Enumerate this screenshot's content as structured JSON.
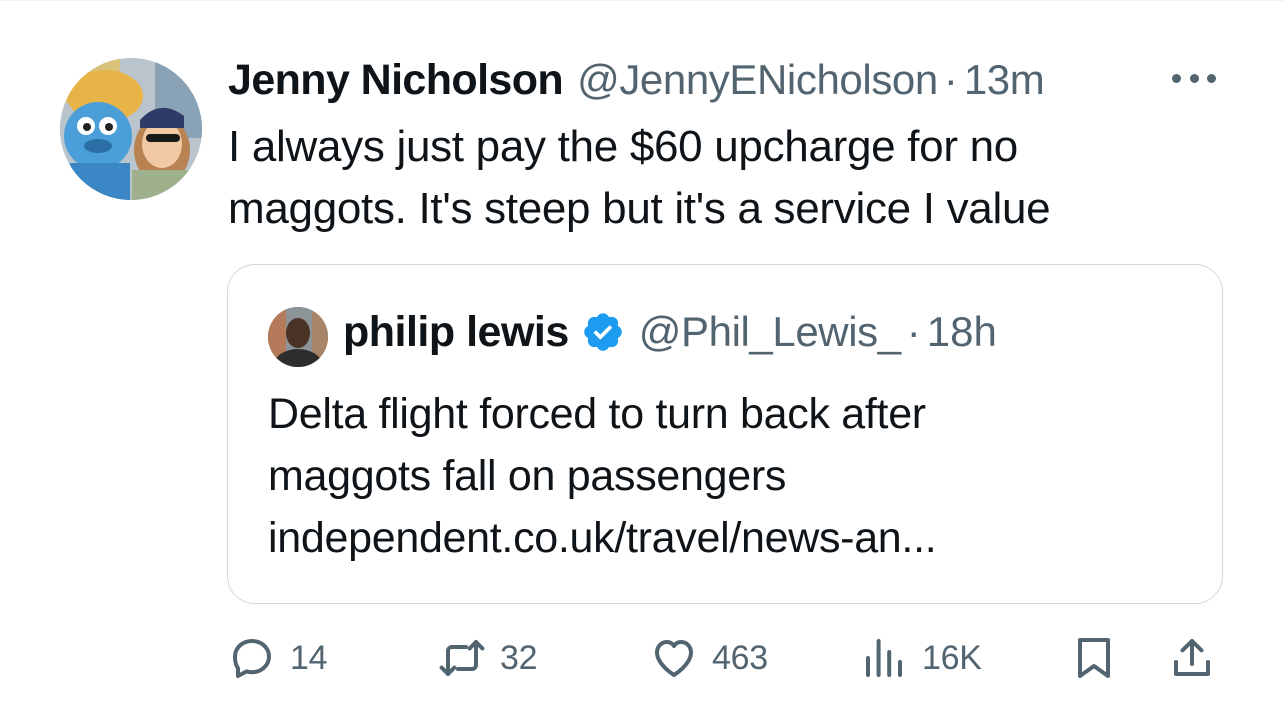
{
  "tweet": {
    "author_name": "Jenny Nicholson",
    "handle": "@JennyENicholson",
    "separator": "·",
    "time": "13m",
    "text_lines": [
      "I always just pay the $60 upcharge for no",
      "maggots. It's steep but it's a service I value"
    ]
  },
  "quoted": {
    "author_name": "philip lewis",
    "handle": "@Phil_Lewis_",
    "separator": "·",
    "time": "18h",
    "text_lines": [
      "Delta flight forced to turn back after",
      "maggots fall on passengers",
      "independent.co.uk/travel/news-an..."
    ]
  },
  "actions": {
    "replies": "14",
    "retweets": "32",
    "likes": "463",
    "views": "16K"
  },
  "icons": {
    "more": "more-icon",
    "verified": "verified-badge-icon",
    "reply": "reply-icon",
    "retweet": "retweet-icon",
    "like": "heart-icon",
    "views": "views-icon",
    "bookmark": "bookmark-icon",
    "share": "share-icon"
  },
  "colors": {
    "text": "#0f1419",
    "secondary": "#536471",
    "border": "#cfd9de",
    "verified": "#1d9bf0"
  }
}
